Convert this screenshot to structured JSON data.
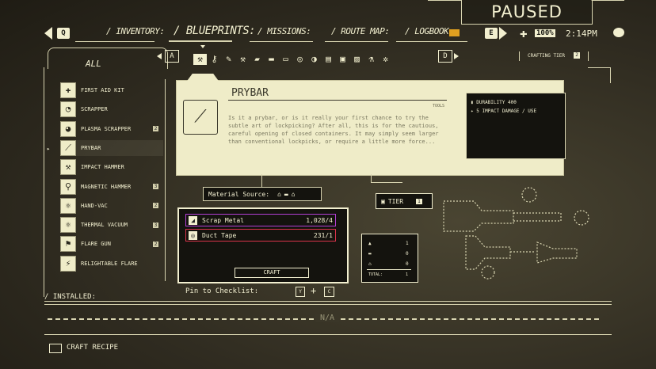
{
  "status": {
    "paused": "PAUSED",
    "battery": "100%",
    "time": "2:14PM"
  },
  "nav": {
    "prev_key": "Q",
    "next_key": "E",
    "tabs": [
      "/ INVENTORY:",
      "/ BLUEPRINTS:",
      "/ MISSIONS:",
      "/ ROUTE MAP:",
      "/ LOGBOOK:"
    ]
  },
  "filter": {
    "all_label": "ALL",
    "prev_key": "A",
    "next_key": "D",
    "crafting_tier_label": "CRAFTING TIER",
    "crafting_tier_value": "2"
  },
  "list": [
    {
      "label": "FIRST AID KIT",
      "num": ""
    },
    {
      "label": "SCRAPPER",
      "num": ""
    },
    {
      "label": "PLASMA SCRAPPER",
      "num": "2"
    },
    {
      "label": "PRYBAR",
      "num": ""
    },
    {
      "label": "IMPACT HAMMER",
      "num": ""
    },
    {
      "label": "MAGNETIC HAMMER",
      "num": "3"
    },
    {
      "label": "HAND-VAC",
      "num": "2"
    },
    {
      "label": "THERMAL VACUUM",
      "num": "3"
    },
    {
      "label": "FLARE GUN",
      "num": "2"
    },
    {
      "label": "RELIGHTABLE FLARE",
      "num": ""
    }
  ],
  "detail": {
    "title": "PRYBAR",
    "category": "TOOLS",
    "description": "Is it a prybar, or is it really your first chance to try the subtle art of lockpicking? After all, this is for the cautious, careful opening of closed containers. It may simply seem larger than conventional lockpicks, or require a little more force...",
    "stats": [
      "DURABILITY  400",
      "5 IMPACT DAMAGE / USE"
    ]
  },
  "material_source_label": "Material Source:",
  "materials": [
    {
      "name": "Scrap Metal",
      "amount": "1,028/4",
      "color": "#b23fd4"
    },
    {
      "name": "Duct Tape",
      "amount": "231/1",
      "color": "#d9344a"
    }
  ],
  "craft_label": "CRAFT",
  "tier": {
    "label": "TIER",
    "value": "1"
  },
  "totals": {
    "rows": [
      "1",
      "0",
      "0"
    ],
    "total_label": "TOTAL:",
    "total_value": "1"
  },
  "pin": {
    "label": "Pin to Checklist:",
    "key1": "Y",
    "key2": "C"
  },
  "installed": {
    "label": "/ INSTALLED:",
    "value": "N/A"
  },
  "footer": {
    "craft_recipe": "CRAFT RECIPE"
  }
}
